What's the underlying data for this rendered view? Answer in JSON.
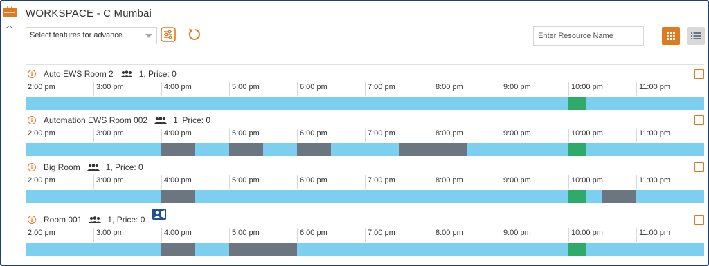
{
  "header": {
    "title": "WORKSPACE - C Mumbai",
    "feature_select": "Select features for advance",
    "search_placeholder": "Enter Resource Name"
  },
  "colors": {
    "accent": "#e07a1f",
    "timeline": "#7dcff0",
    "booked": "#6b7680",
    "current": "#2eaa6b",
    "border": "#1f3f7a"
  },
  "hours": [
    "2:00 pm",
    "3:00 pm",
    "4:00 pm",
    "5:00 pm",
    "6:00 pm",
    "7:00 pm",
    "8:00 pm",
    "9:00 pm",
    "10:00 pm",
    "11:00 pm"
  ],
  "rooms": [
    {
      "name": "Auto EWS Room 2",
      "meta": "1, Price: 0",
      "booked": [],
      "current": [
        [
          10.0,
          10.25
        ]
      ]
    },
    {
      "name": "Automation EWS Room 002",
      "meta": "1, Price: 0",
      "booked": [
        [
          4.0,
          4.5
        ],
        [
          5.0,
          5.5
        ],
        [
          6.0,
          6.5
        ],
        [
          7.5,
          8.5
        ]
      ],
      "current": [
        [
          10.0,
          10.25
        ]
      ]
    },
    {
      "name": "Big Room",
      "meta": "1, Price: 0",
      "booked": [
        [
          4.0,
          4.5
        ],
        [
          10.5,
          11.0
        ]
      ],
      "current": [
        [
          10.0,
          10.25
        ]
      ]
    },
    {
      "name": "Room 001",
      "meta": "1, Price: 0",
      "video": true,
      "booked": [
        [
          4.0,
          4.5
        ],
        [
          5.0,
          6.0
        ]
      ],
      "current": [
        [
          10.0,
          10.25
        ]
      ]
    }
  ]
}
